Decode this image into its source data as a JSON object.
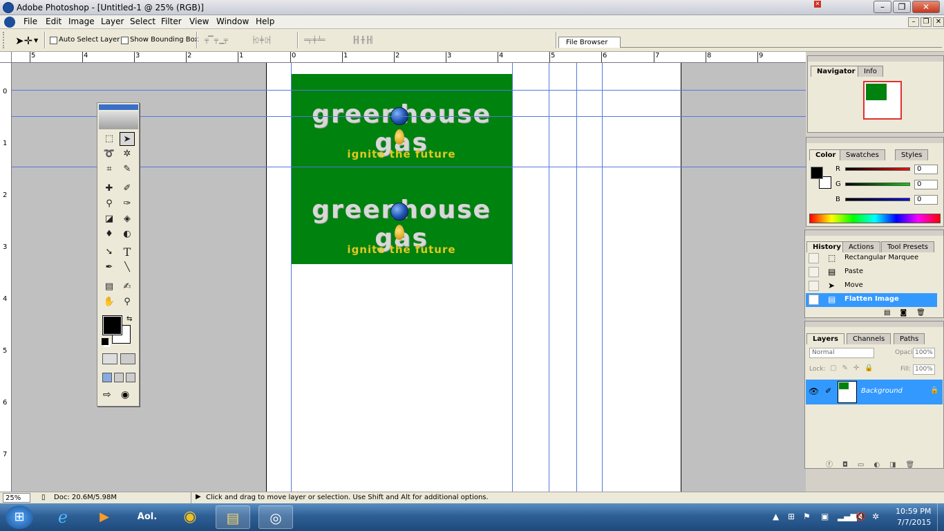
{
  "window": {
    "title": "Adobe Photoshop - [Untitled-1 @ 25% (RGB)]",
    "controls": {
      "minimize": "–",
      "maximize": "❐",
      "close": "✕"
    }
  },
  "menu": [
    "File",
    "Edit",
    "Image",
    "Layer",
    "Select",
    "Filter",
    "View",
    "Window",
    "Help"
  ],
  "mdi_controls": {
    "minimize": "–",
    "restore": "❐",
    "close": "✕"
  },
  "options": {
    "auto_select_layer": {
      "label": "Auto Select Layer",
      "checked": false
    },
    "show_bounding_box": {
      "label": "Show Bounding Box",
      "checked": false
    }
  },
  "file_browser": {
    "label": "File Browser"
  },
  "rulers": {
    "top_labels": [
      "5",
      "4",
      "3",
      "2",
      "1",
      "0",
      "1",
      "2",
      "3",
      "4",
      "5",
      "6",
      "7",
      "8",
      "9"
    ],
    "left_labels": [
      "0",
      "1",
      "2",
      "3",
      "4",
      "5",
      "6",
      "7"
    ]
  },
  "document": {
    "banner_color": "#00820f",
    "headline": "greenhouse gas",
    "tagline": "ignite the future"
  },
  "navigator": {
    "tabs": [
      "Navigator",
      "Info"
    ]
  },
  "color_palette": {
    "tabs": [
      "Color",
      "Swatches",
      "Styles"
    ],
    "channels": [
      {
        "label": "R",
        "value": "0",
        "color": "#ee1111"
      },
      {
        "label": "G",
        "value": "0",
        "color": "#11cc11"
      },
      {
        "label": "B",
        "value": "0",
        "color": "#1111dd"
      }
    ]
  },
  "history": {
    "tabs": [
      "History",
      "Actions",
      "Tool Presets"
    ],
    "items": [
      {
        "label": "Rectangular Marquee",
        "icon": "marquee-icon",
        "active": false
      },
      {
        "label": "Paste",
        "icon": "document-icon",
        "active": false
      },
      {
        "label": "Move",
        "icon": "move-icon",
        "active": false
      },
      {
        "label": "Flatten Image",
        "icon": "document-icon",
        "active": true
      }
    ]
  },
  "layers": {
    "tabs": [
      "Layers",
      "Channels",
      "Paths"
    ],
    "blend_mode": "Normal",
    "opacity_label": "Opacity:",
    "opacity": "100%",
    "lock_label": "Lock:",
    "fill_label": "Fill:",
    "fill": "100%",
    "layer_name": "Background"
  },
  "status": {
    "zoom": "25%",
    "doc": "Doc: 20.6M/5.98M",
    "hint": "Click and drag to move layer or selection.  Use Shift and Alt for additional options."
  },
  "taskbar": {
    "apps": [
      {
        "name": "start-button",
        "glyph": "⊞"
      },
      {
        "name": "internet-explorer-icon",
        "glyph": "e"
      },
      {
        "name": "media-player-icon",
        "glyph": "▶"
      },
      {
        "name": "aol-icon",
        "glyph": "Aol."
      },
      {
        "name": "chrome-icon",
        "glyph": "◉"
      },
      {
        "name": "file-explorer-icon",
        "glyph": "▤"
      },
      {
        "name": "photoshop-taskbar-icon",
        "glyph": "◎"
      }
    ],
    "time": "10:59 PM",
    "date": "7/7/2015"
  }
}
